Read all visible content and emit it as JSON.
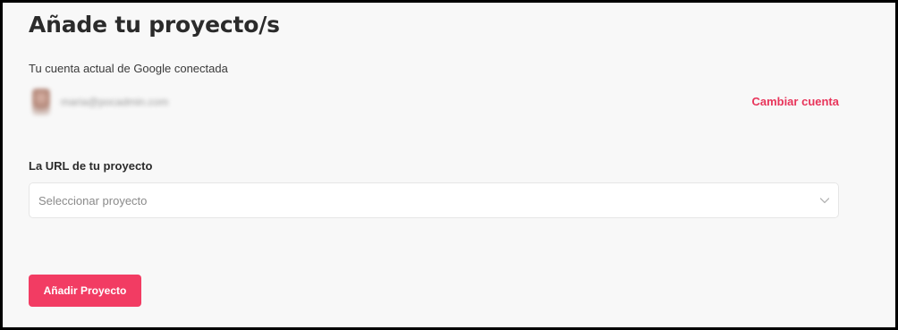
{
  "header": {
    "title": "Añade tu proyecto/s"
  },
  "account": {
    "connected_label": "Tu cuenta actual de Google conectada",
    "email": "maria@pocadmin.com",
    "change_account_label": "Cambiar cuenta"
  },
  "project": {
    "url_label": "La URL de tu proyecto",
    "select_placeholder": "Seleccionar proyecto"
  },
  "actions": {
    "add_project_label": "Añadir Proyecto"
  },
  "colors": {
    "accent": "#f23c63",
    "link": "#e8345a",
    "background": "#f8f8f8"
  }
}
